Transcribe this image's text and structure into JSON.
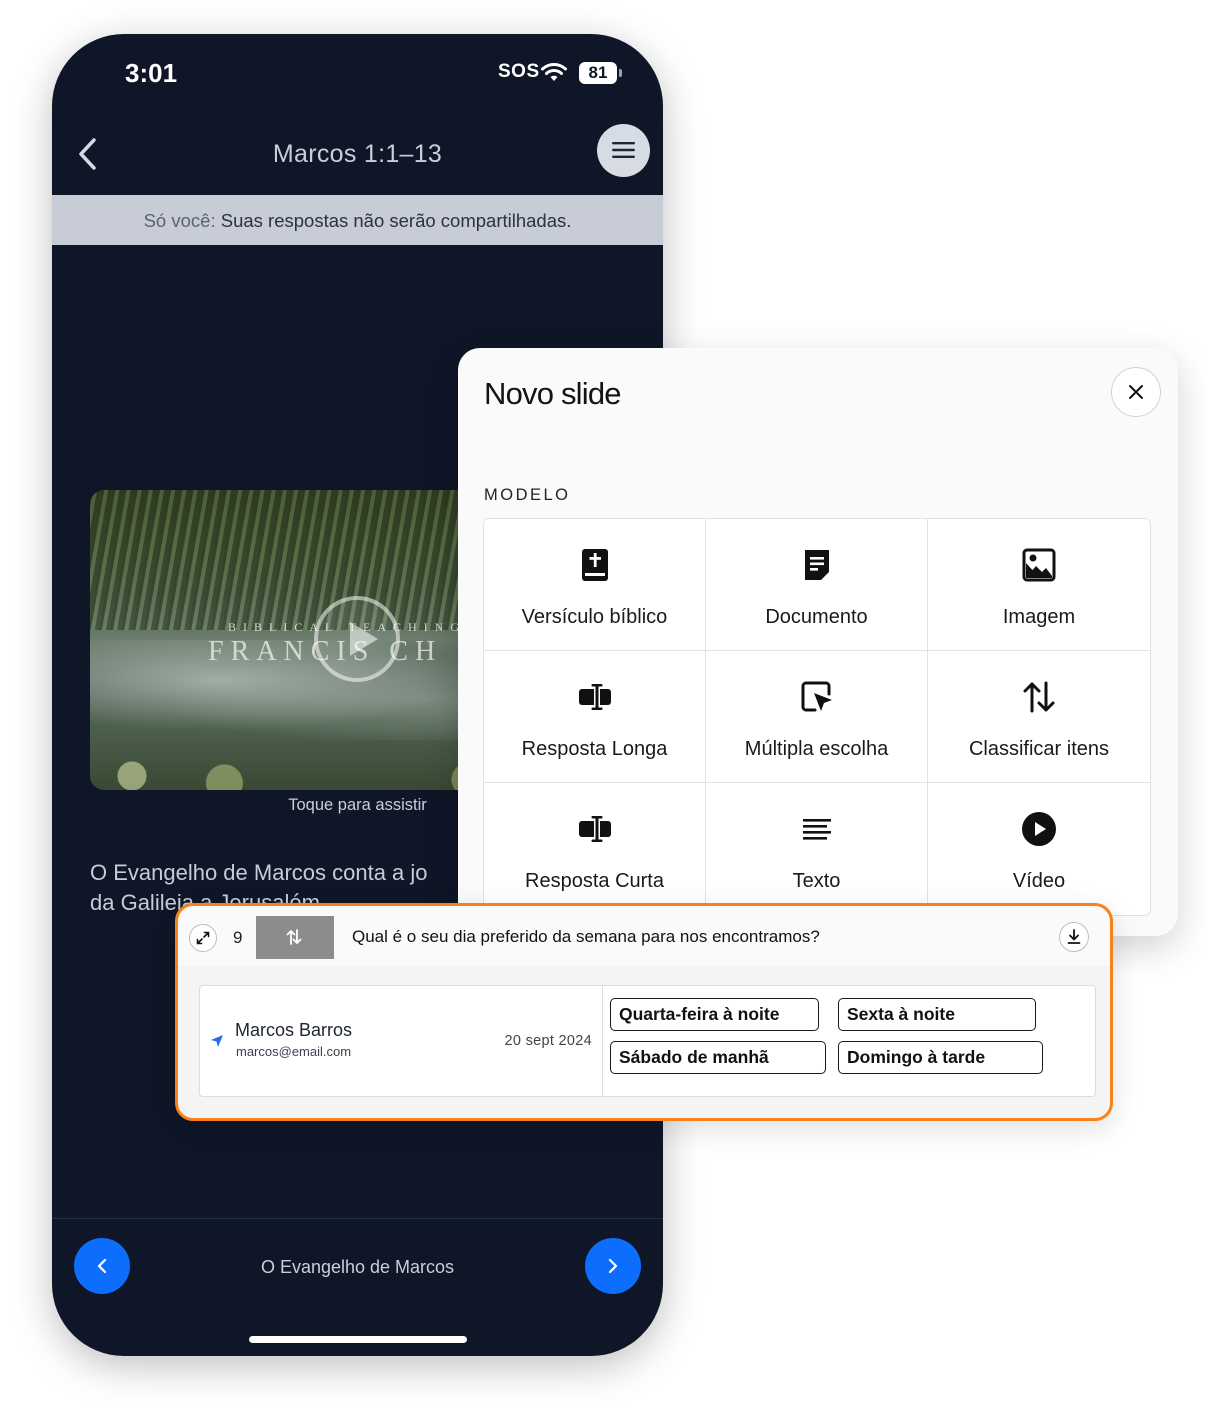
{
  "status_bar": {
    "time": "3:01",
    "sos": "SOS",
    "battery": "81"
  },
  "nav": {
    "title": "Marcos 1:1–13",
    "back_icon": "chevron-left-icon",
    "menu_icon": "hamburger-menu-icon"
  },
  "privacy_banner": {
    "label": "Só você:",
    "text": "Suas respostas não serão compartilhadas."
  },
  "video": {
    "overline": "BIBLICAL TEACHING FR",
    "headline": "FRANCIS CH",
    "caption": "Toque para assistir"
  },
  "body_text": {
    "line1": "O Evangelho de Marcos conta a jo",
    "line2": "da Galileia a Jerusalém"
  },
  "bottom_nav": {
    "title": "O Evangelho de Marcos"
  },
  "modal": {
    "title": "Novo slide",
    "section_label": "MODELO",
    "templates": [
      {
        "label": "Versículo bíblico",
        "icon": "bible-icon"
      },
      {
        "label": "Documento",
        "icon": "document-icon"
      },
      {
        "label": "Imagem",
        "icon": "image-icon"
      },
      {
        "label": "Resposta Longa",
        "icon": "text-input-icon"
      },
      {
        "label": "Múltipla escolha",
        "icon": "cursor-select-icon"
      },
      {
        "label": "Classificar itens",
        "icon": "sort-arrows-icon"
      },
      {
        "label": "Resposta Curta",
        "icon": "text-input-icon"
      },
      {
        "label": "Texto",
        "icon": "align-left-icon"
      },
      {
        "label": "Vídeo",
        "icon": "play-circle-icon"
      }
    ]
  },
  "response": {
    "number": "9",
    "question": "Qual é o seu dia preferido da semana para nos encontramos?",
    "user_name": "Marcos Barros",
    "user_email": "marcos@email.com",
    "date": "20 sept 2024",
    "answers": [
      "Quarta-feira à noite",
      "Sexta à noite",
      "Sábado de manhã",
      "Domingo à tarde"
    ]
  },
  "colors": {
    "accent": "#0d6efd",
    "highlight_border": "#f7821b",
    "phone_bg": "#0f1627"
  }
}
